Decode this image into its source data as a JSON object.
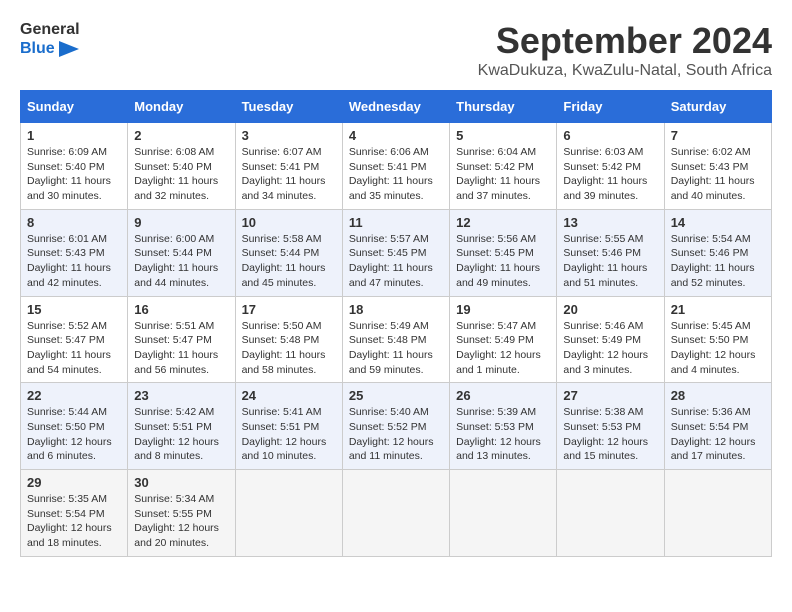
{
  "logo": {
    "line1": "General",
    "line2": "Blue"
  },
  "title": "September 2024",
  "location": "KwaDukuza, KwaZulu-Natal, South Africa",
  "headers": [
    "Sunday",
    "Monday",
    "Tuesday",
    "Wednesday",
    "Thursday",
    "Friday",
    "Saturday"
  ],
  "weeks": [
    [
      {
        "day": "1",
        "sunrise": "6:09 AM",
        "sunset": "5:40 PM",
        "daylight": "11 hours and 30 minutes."
      },
      {
        "day": "2",
        "sunrise": "6:08 AM",
        "sunset": "5:40 PM",
        "daylight": "11 hours and 32 minutes."
      },
      {
        "day": "3",
        "sunrise": "6:07 AM",
        "sunset": "5:41 PM",
        "daylight": "11 hours and 34 minutes."
      },
      {
        "day": "4",
        "sunrise": "6:06 AM",
        "sunset": "5:41 PM",
        "daylight": "11 hours and 35 minutes."
      },
      {
        "day": "5",
        "sunrise": "6:04 AM",
        "sunset": "5:42 PM",
        "daylight": "11 hours and 37 minutes."
      },
      {
        "day": "6",
        "sunrise": "6:03 AM",
        "sunset": "5:42 PM",
        "daylight": "11 hours and 39 minutes."
      },
      {
        "day": "7",
        "sunrise": "6:02 AM",
        "sunset": "5:43 PM",
        "daylight": "11 hours and 40 minutes."
      }
    ],
    [
      {
        "day": "8",
        "sunrise": "6:01 AM",
        "sunset": "5:43 PM",
        "daylight": "11 hours and 42 minutes."
      },
      {
        "day": "9",
        "sunrise": "6:00 AM",
        "sunset": "5:44 PM",
        "daylight": "11 hours and 44 minutes."
      },
      {
        "day": "10",
        "sunrise": "5:58 AM",
        "sunset": "5:44 PM",
        "daylight": "11 hours and 45 minutes."
      },
      {
        "day": "11",
        "sunrise": "5:57 AM",
        "sunset": "5:45 PM",
        "daylight": "11 hours and 47 minutes."
      },
      {
        "day": "12",
        "sunrise": "5:56 AM",
        "sunset": "5:45 PM",
        "daylight": "11 hours and 49 minutes."
      },
      {
        "day": "13",
        "sunrise": "5:55 AM",
        "sunset": "5:46 PM",
        "daylight": "11 hours and 51 minutes."
      },
      {
        "day": "14",
        "sunrise": "5:54 AM",
        "sunset": "5:46 PM",
        "daylight": "11 hours and 52 minutes."
      }
    ],
    [
      {
        "day": "15",
        "sunrise": "5:52 AM",
        "sunset": "5:47 PM",
        "daylight": "11 hours and 54 minutes."
      },
      {
        "day": "16",
        "sunrise": "5:51 AM",
        "sunset": "5:47 PM",
        "daylight": "11 hours and 56 minutes."
      },
      {
        "day": "17",
        "sunrise": "5:50 AM",
        "sunset": "5:48 PM",
        "daylight": "11 hours and 58 minutes."
      },
      {
        "day": "18",
        "sunrise": "5:49 AM",
        "sunset": "5:48 PM",
        "daylight": "11 hours and 59 minutes."
      },
      {
        "day": "19",
        "sunrise": "5:47 AM",
        "sunset": "5:49 PM",
        "daylight": "12 hours and 1 minute."
      },
      {
        "day": "20",
        "sunrise": "5:46 AM",
        "sunset": "5:49 PM",
        "daylight": "12 hours and 3 minutes."
      },
      {
        "day": "21",
        "sunrise": "5:45 AM",
        "sunset": "5:50 PM",
        "daylight": "12 hours and 4 minutes."
      }
    ],
    [
      {
        "day": "22",
        "sunrise": "5:44 AM",
        "sunset": "5:50 PM",
        "daylight": "12 hours and 6 minutes."
      },
      {
        "day": "23",
        "sunrise": "5:42 AM",
        "sunset": "5:51 PM",
        "daylight": "12 hours and 8 minutes."
      },
      {
        "day": "24",
        "sunrise": "5:41 AM",
        "sunset": "5:51 PM",
        "daylight": "12 hours and 10 minutes."
      },
      {
        "day": "25",
        "sunrise": "5:40 AM",
        "sunset": "5:52 PM",
        "daylight": "12 hours and 11 minutes."
      },
      {
        "day": "26",
        "sunrise": "5:39 AM",
        "sunset": "5:53 PM",
        "daylight": "12 hours and 13 minutes."
      },
      {
        "day": "27",
        "sunrise": "5:38 AM",
        "sunset": "5:53 PM",
        "daylight": "12 hours and 15 minutes."
      },
      {
        "day": "28",
        "sunrise": "5:36 AM",
        "sunset": "5:54 PM",
        "daylight": "12 hours and 17 minutes."
      }
    ],
    [
      {
        "day": "29",
        "sunrise": "5:35 AM",
        "sunset": "5:54 PM",
        "daylight": "12 hours and 18 minutes."
      },
      {
        "day": "30",
        "sunrise": "5:34 AM",
        "sunset": "5:55 PM",
        "daylight": "12 hours and 20 minutes."
      },
      null,
      null,
      null,
      null,
      null
    ]
  ]
}
